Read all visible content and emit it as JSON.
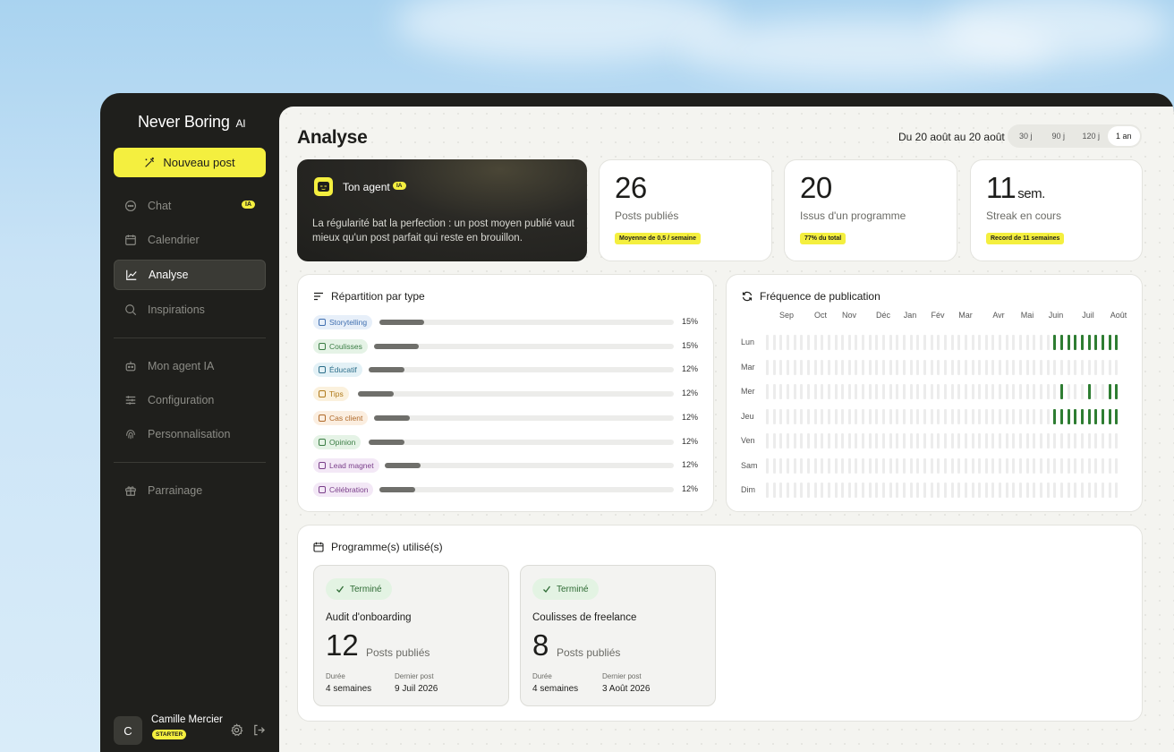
{
  "sidebar": {
    "brand": "Never Boring",
    "brand_suffix": "AI",
    "new_post_label": "Nouveau post",
    "items": [
      {
        "label": "Chat",
        "icon": "chat-bubble-icon",
        "badge": "IA"
      },
      {
        "label": "Calendrier",
        "icon": "calendar-icon"
      },
      {
        "label": "Analyse",
        "icon": "line-chart-icon",
        "active": true
      },
      {
        "label": "Inspirations",
        "icon": "search-icon"
      },
      {
        "label": "Mon agent IA",
        "icon": "robot-icon"
      },
      {
        "label": "Configuration",
        "icon": "sliders-icon"
      },
      {
        "label": "Personnalisation",
        "icon": "fingerprint-icon"
      },
      {
        "label": "Parrainage",
        "icon": "gift-icon"
      }
    ],
    "user": {
      "initial": "C",
      "name": "Camille Mercier",
      "plan": "STARTER"
    }
  },
  "header": {
    "title": "Analyse",
    "date_range": "Du 20 août au 20 août",
    "ranges": [
      {
        "label": "30 j",
        "active": false
      },
      {
        "label": "90 j",
        "active": false
      },
      {
        "label": "120 j",
        "active": false
      },
      {
        "label": "1 an",
        "active": true
      }
    ]
  },
  "agent": {
    "title": "Ton agent",
    "badge": "IA",
    "text": "La régularité bat la perfection : un post moyen publié vaut mieux qu'un post parfait qui reste en brouillon."
  },
  "stats": [
    {
      "value": "26",
      "unit": "",
      "label": "Posts publiés",
      "badge": "Moyenne de 0,5 / semaine"
    },
    {
      "value": "20",
      "unit": "",
      "label": "Issus d'un programme",
      "badge": "77% du total"
    },
    {
      "value": "11",
      "unit": "sem.",
      "label": "Streak en cours",
      "badge": "Record de 11 semaines"
    }
  ],
  "types": {
    "title": "Répartition par type",
    "rows": [
      {
        "label": "Storytelling",
        "pct": "15%",
        "fraction": 0.15,
        "color": "#3f6fb0",
        "bg": "#e7eff9"
      },
      {
        "label": "Coulisses",
        "pct": "15%",
        "fraction": 0.15,
        "color": "#3a7d44",
        "bg": "#e5f3e6"
      },
      {
        "label": "Éducatif",
        "pct": "12%",
        "fraction": 0.12,
        "color": "#2c6e8a",
        "bg": "#e3f1f6"
      },
      {
        "label": "Tips",
        "pct": "12%",
        "fraction": 0.12,
        "color": "#b07a1a",
        "bg": "#fbf1dd"
      },
      {
        "label": "Cas client",
        "pct": "12%",
        "fraction": 0.12,
        "color": "#b06a2a",
        "bg": "#fbeee0"
      },
      {
        "label": "Opinion",
        "pct": "12%",
        "fraction": 0.12,
        "color": "#3a7d44",
        "bg": "#e5f3e6"
      },
      {
        "label": "Lead magnet",
        "pct": "12%",
        "fraction": 0.12,
        "color": "#7a3f8a",
        "bg": "#f3e8f6"
      },
      {
        "label": "Célébration",
        "pct": "12%",
        "fraction": 0.12,
        "color": "#7a3f8a",
        "bg": "#f3e8f6"
      }
    ]
  },
  "frequency": {
    "title": "Fréquence de publication",
    "months": [
      "Sep",
      "Oct",
      "Nov",
      "Déc",
      "Jan",
      "Fév",
      "Mar",
      "Avr",
      "Mai",
      "Juin",
      "Juil",
      "Août"
    ],
    "days": [
      "Lun",
      "Mar",
      "Mer",
      "Jeu",
      "Ven",
      "Sam",
      "Dim"
    ],
    "weeks": 52,
    "active": {
      "Lun": [
        42,
        43,
        44,
        45,
        46,
        47,
        48,
        49,
        50,
        51
      ],
      "Mer": [
        43,
        47,
        50,
        51
      ],
      "Jeu": [
        42,
        43,
        44,
        45,
        46,
        47,
        48,
        49,
        50,
        51
      ]
    },
    "on_color": "#2e7d32"
  },
  "programs": {
    "title": "Programme(s) utilisé(s)",
    "items": [
      {
        "status": "Terminé",
        "name": "Audit d'onboarding",
        "count": "12",
        "unit": "Posts publiés",
        "duration_label": "Durée",
        "duration": "4 semaines",
        "last_label": "Dernier post",
        "last": "9 Juil 2026"
      },
      {
        "status": "Terminé",
        "name": "Coulisses de freelance",
        "count": "8",
        "unit": "Posts publiés",
        "duration_label": "Durée",
        "duration": "4 semaines",
        "last_label": "Dernier post",
        "last": "3 Août 2026"
      }
    ]
  },
  "colors": {
    "accent": "#f4ef3f",
    "sidebar_bg": "#1f1f1c",
    "main_bg": "#f4f4f0"
  }
}
